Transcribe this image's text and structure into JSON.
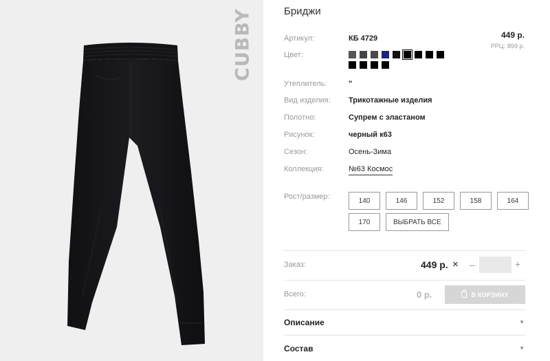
{
  "product": {
    "title": "Бриджи",
    "brand": "CUBBY",
    "price": "449 р.",
    "rrc_label": "РРЦ:",
    "rrc_value": "899 р."
  },
  "attributes": {
    "article_label": "Артикул:",
    "article_value": "КБ 4729",
    "color_label": "Цвет:",
    "swatches": [
      "#555555",
      "#444444",
      "#4a4a4a",
      "#1a237e",
      "#111111",
      "#000000",
      "#000000",
      "#000000",
      "#000000",
      "#000000",
      "#000000",
      "#000000",
      "#000000"
    ],
    "selected_swatch": 5,
    "insulation_label": "Утеплитель:",
    "insulation_value": "\"",
    "type_label": "Вид изделия:",
    "type_value": "Трикотажные изделия",
    "fabric_label": "Полотно:",
    "fabric_value": "Супрем с эластаном",
    "pattern_label": "Рисунок:",
    "pattern_value": "черный к63",
    "season_label": "Сезон:",
    "season_value": "Осень-Зима",
    "collection_label": "Коллекция:",
    "collection_value": "№63 Космос"
  },
  "sizes": {
    "label": "Рост/размер:",
    "options": [
      "140",
      "146",
      "152",
      "158",
      "164",
      "170"
    ],
    "select_all": "ВЫБРАТЬ ВСЕ"
  },
  "order": {
    "label": "Заказ:",
    "price": "449 р.",
    "times": "×",
    "minus": "–",
    "plus": "+",
    "quantity": ""
  },
  "total": {
    "label": "Всего:",
    "value": "0 р.",
    "cart_button": "В КОРЗИНУ"
  },
  "accordions": {
    "description": "Описание",
    "composition": "Состав"
  }
}
